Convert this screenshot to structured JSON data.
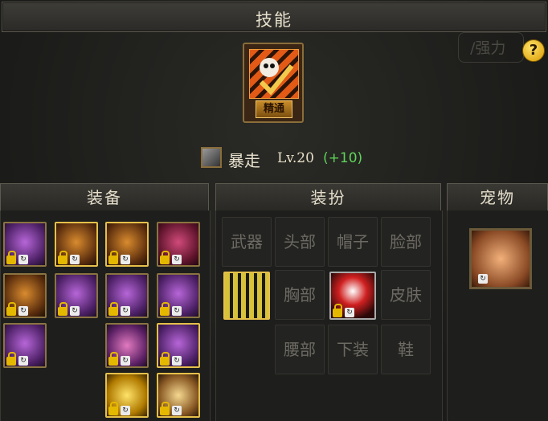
{
  "window": {
    "title": "技能"
  },
  "help": {
    "icon": "help-icon",
    "glyph": "?"
  },
  "ghost_tab": {
    "label": "/强力"
  },
  "skill": {
    "icon": "skill-frenzy-icon",
    "mastery_label": "精通",
    "name": "暴走",
    "level": "Lv.20",
    "bonus": "(+10)",
    "bonus_color": "#5fd35a"
  },
  "panels": {
    "equipment": {
      "title": "装备"
    },
    "avatar": {
      "title": "装扮"
    },
    "pet": {
      "title": "宠物"
    }
  },
  "equipment_slots": [
    {
      "icon": "weapon-purple-icon",
      "locked": true
    },
    {
      "icon": "shoulder-gold-icon",
      "locked": true
    },
    {
      "icon": "top-orange-icon",
      "locked": true
    },
    {
      "icon": "pants-pinkred-icon",
      "locked": true
    },
    {
      "icon": "belt-orange-icon",
      "locked": true
    },
    {
      "icon": "shoes-purple-icon",
      "locked": true
    },
    {
      "icon": "bracelet-purple-icon",
      "locked": true
    },
    {
      "icon": "necklace-purple-icon",
      "locked": true
    },
    {
      "icon": "ring-purple-icon",
      "locked": true
    },
    {
      "icon": "subequip-pink-icon",
      "locked": true
    },
    {
      "icon": "earring-purple-icon",
      "locked": true
    },
    {
      "icon": "magicstone-gold-icon",
      "locked": true
    },
    {
      "icon": "title-gold-icon",
      "locked": true
    }
  ],
  "avatar_slots": {
    "weapon": "武器",
    "head": "头部",
    "hat": "帽子",
    "face": "脸部",
    "chest": "胸部",
    "skin": "皮肤",
    "waist": "腰部",
    "pants": "下装",
    "shoes": "鞋"
  },
  "pet": {
    "icon": "pet-fox-icon",
    "locked": false
  }
}
